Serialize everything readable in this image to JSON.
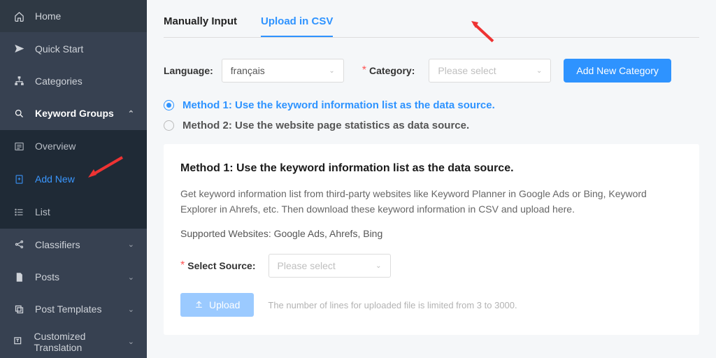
{
  "sidebar": {
    "items": [
      {
        "label": "Home"
      },
      {
        "label": "Quick Start"
      },
      {
        "label": "Categories"
      },
      {
        "label": "Keyword Groups"
      },
      {
        "label": "Classifiers"
      },
      {
        "label": "Posts"
      },
      {
        "label": "Post Templates"
      },
      {
        "label": "Customized Translation"
      }
    ],
    "keyword_groups_sub": [
      {
        "label": "Overview"
      },
      {
        "label": "Add New"
      },
      {
        "label": "List"
      }
    ]
  },
  "tabs": {
    "manual": "Manually Input",
    "csv": "Upload in CSV"
  },
  "form": {
    "language_label": "Language:",
    "language_value": "français",
    "category_label": "Category:",
    "category_placeholder": "Please select",
    "add_category_btn": "Add New Category"
  },
  "methods": {
    "m1": "Method 1: Use the keyword information list as the data source.",
    "m2": "Method 2: Use the website page statistics as data source."
  },
  "card": {
    "title": "Method 1: Use the keyword information list as the data source.",
    "desc": "Get keyword information list from third-party websites like Keyword Planner in Google Ads or Bing, Keyword Explorer in Ahrefs, etc. Then download these keyword information in CSV and upload here.",
    "supported": "Supported Websites: Google Ads, Ahrefs, Bing",
    "select_source_label": "Select Source:",
    "select_source_placeholder": "Please select",
    "upload_btn": "Upload",
    "upload_hint": "The number of lines for uploaded file is limited from 3 to 3000."
  }
}
